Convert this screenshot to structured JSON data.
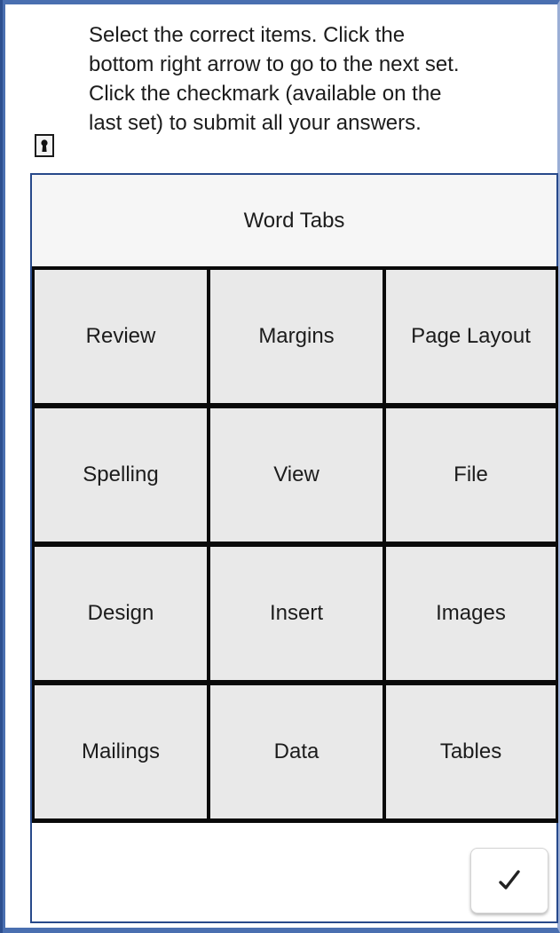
{
  "instructions": {
    "lines": [
      "Select the correct items. Click the",
      "bottom right arrow to go to the next set.",
      "Click the checkmark (available on the",
      "last set) to submit all your answers."
    ],
    "icon": "keyhole-lock-icon"
  },
  "quiz": {
    "title": "Word Tabs",
    "items": [
      "Review",
      "Margins",
      "Page Layout",
      "Spelling",
      "View",
      "File",
      "Design",
      "Insert",
      "Images",
      "Mailings",
      "Data",
      "Tables"
    ],
    "submit_icon": "checkmark-icon"
  },
  "colors": {
    "frame_border": "#4a6fb0",
    "panel_border": "#27498a",
    "tile_background": "#e9e9e9",
    "grid_lines": "#0a0a0a"
  }
}
